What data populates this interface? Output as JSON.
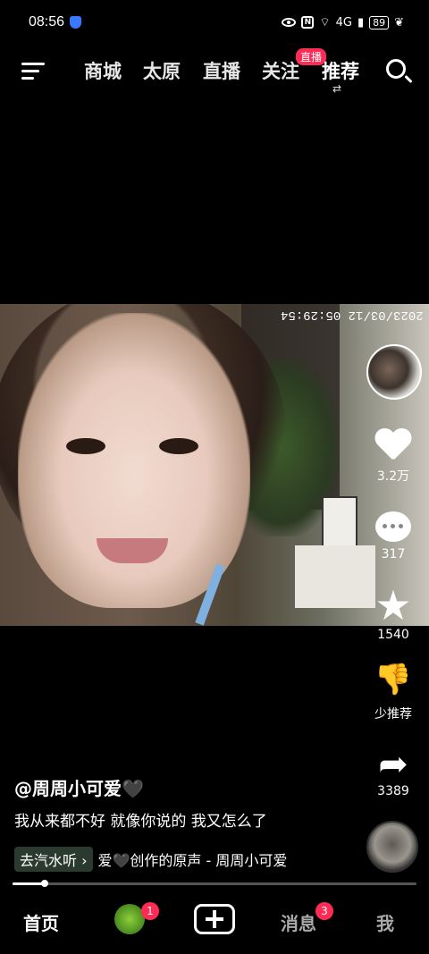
{
  "status_bar": {
    "time": "08:56",
    "network": "4G",
    "battery": "89"
  },
  "top_nav": {
    "tabs": [
      "商城",
      "太原",
      "直播",
      "关注",
      "推荐"
    ],
    "active_tab": "推荐",
    "live_badge": "直播"
  },
  "video": {
    "timestamp": "2023/03/12 05:29:54"
  },
  "actions": {
    "likes": "3.2万",
    "comments": "317",
    "favorites": "1540",
    "dislike_label": "少推荐",
    "shares": "3389"
  },
  "post": {
    "author": "@周周小可爱🖤",
    "description": "我从来都不好 就像你说的 我又怎么了",
    "music_chip": "去汽水听 ›",
    "music_title": "爱🖤创作的原声 - 周周小可爱",
    "progress": 0.08
  },
  "bottom_nav": {
    "home": "首页",
    "friends_badge": "1",
    "messages": "消息",
    "messages_badge": "3",
    "me": "我"
  }
}
